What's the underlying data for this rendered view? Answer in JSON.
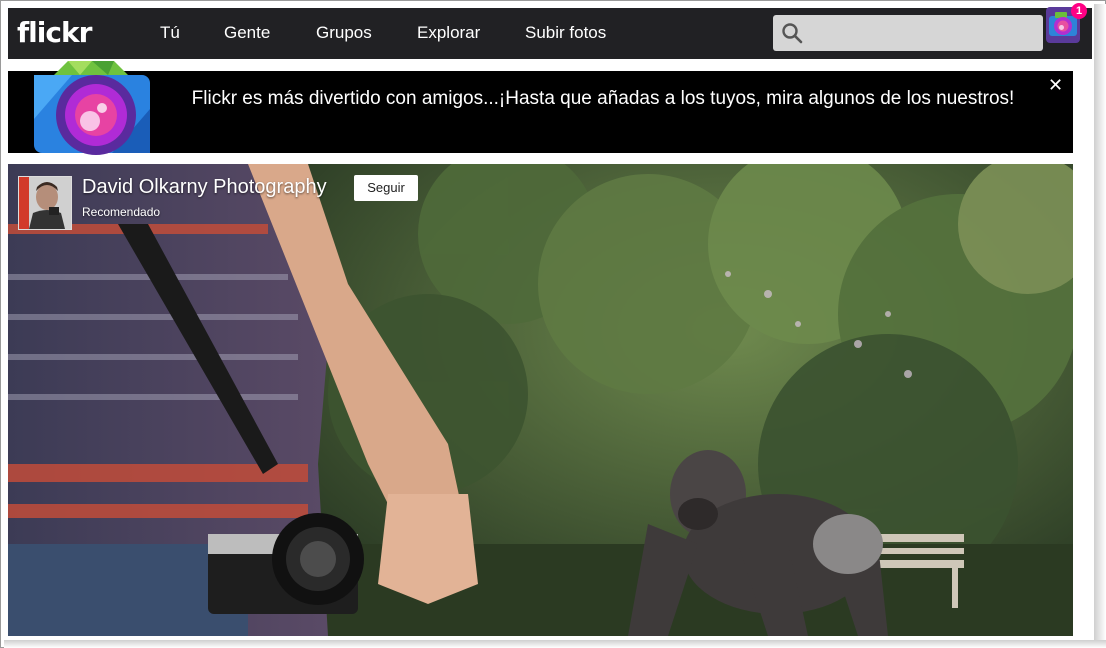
{
  "app": {
    "logo": "flickr"
  },
  "nav": {
    "items": [
      "Tú",
      "Gente",
      "Grupos",
      "Explorar",
      "Subir fotos"
    ]
  },
  "search": {
    "placeholder": "",
    "value": ""
  },
  "notifications": {
    "count": "1"
  },
  "banner": {
    "message": "Flickr es más divertido con amigos...¡Hasta que añadas a los tuyos, mira algunos de los nuestros!",
    "close_label": "✕"
  },
  "featured": {
    "author": "David Olkarny Photography",
    "subtitle": "Recomendado",
    "follow_label": "Seguir"
  },
  "colors": {
    "topbar": "#212124",
    "badge": "#ff0084",
    "banner": "#000000"
  }
}
